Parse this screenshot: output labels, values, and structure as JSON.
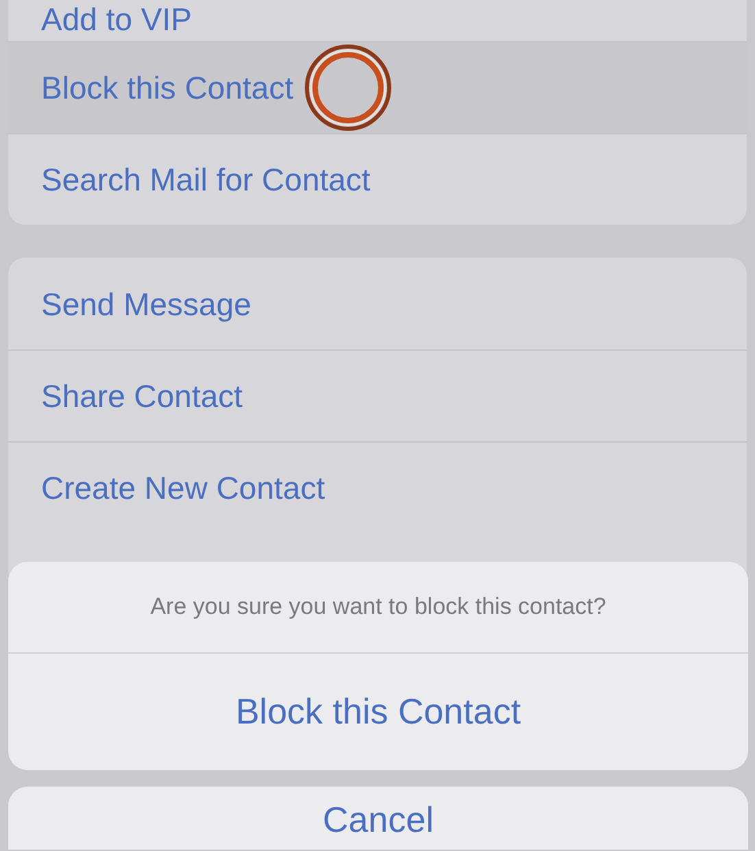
{
  "menu_groups": [
    {
      "items": [
        {
          "label": "Add to VIP",
          "selected": false,
          "touch_indicator": false
        },
        {
          "label": "Block this Contact",
          "selected": true,
          "touch_indicator": true
        },
        {
          "label": "Search Mail for Contact",
          "selected": false,
          "touch_indicator": false
        }
      ]
    },
    {
      "items": [
        {
          "label": "Send Message",
          "selected": false,
          "touch_indicator": false
        },
        {
          "label": "Share Contact",
          "selected": false,
          "touch_indicator": false
        },
        {
          "label": "Create New Contact",
          "selected": false,
          "touch_indicator": false
        }
      ]
    }
  ],
  "action_sheet": {
    "message": "Are you sure you want to block this contact?",
    "action": "Block this Contact",
    "cancel": "Cancel"
  }
}
